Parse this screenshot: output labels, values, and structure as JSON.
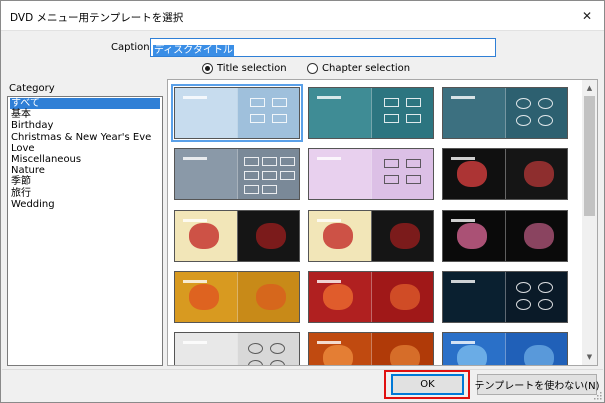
{
  "window": {
    "title": "DVD メニュー用テンプレートを選択",
    "close_glyph": "✕"
  },
  "caption": {
    "label": "Caption:",
    "value": "ディスクタイトル"
  },
  "selection_mode": {
    "options": [
      {
        "label": "Title selection",
        "checked": true
      },
      {
        "label": "Chapter selection",
        "checked": false
      }
    ]
  },
  "category": {
    "label": "Category",
    "items": [
      "すべて",
      "基本",
      "Birthday",
      "Christmas & New Year's Eve",
      "Love",
      "Miscellaneous",
      "Nature",
      "季節",
      "旅行",
      "Wedding"
    ],
    "selected_index": 0
  },
  "templates": {
    "selected_index": 0,
    "themes": [
      {
        "left": "#c7dcee",
        "right": "#9fc0dc",
        "style": "frames4",
        "accent": "#4a8cc8"
      },
      {
        "left": "#3f8c95",
        "right": "#2c7580",
        "style": "frames4",
        "accent": "#5fb0b8"
      },
      {
        "left": "#3c7080",
        "right": "#2d6070",
        "style": "ovals4",
        "accent": "#6aa8b8"
      },
      {
        "left": "#8a99a8",
        "right": "#7a8998",
        "style": "frames6",
        "accent": "#a8b8c8"
      },
      {
        "left": "#e8d0ee",
        "right": "#dcc0e6",
        "style": "party",
        "accent": "#c03030"
      },
      {
        "left": "#101010",
        "right": "#151515",
        "style": "balloons",
        "accent": "#e04040"
      },
      {
        "left": "#f2e6b8",
        "right": "#151515",
        "style": "xmas",
        "accent": "#c02020"
      },
      {
        "left": "#f2e6b8",
        "right": "#151515",
        "style": "xmas",
        "accent": "#c02020"
      },
      {
        "left": "#0a0a0a",
        "right": "#0a0a0a",
        "style": "fireworks",
        "accent": "#e06a9a"
      },
      {
        "left": "#d89a20",
        "right": "#c88a18",
        "style": "hearts",
        "accent": "#e05020"
      },
      {
        "left": "#b02020",
        "right": "#a01818",
        "style": "redhearts",
        "accent": "#f07030"
      },
      {
        "left": "#0a2030",
        "right": "#0a1a28",
        "style": "ovals4",
        "accent": "#2a6a8a"
      },
      {
        "left": "#e8e8e8",
        "right": "#d8d8d8",
        "style": "rings",
        "accent": "#808080"
      },
      {
        "left": "#c04a10",
        "right": "#b03a08",
        "style": "sunset",
        "accent": "#f09040"
      },
      {
        "left": "#2a70c8",
        "right": "#2060b8",
        "style": "city",
        "accent": "#80c0f0"
      }
    ]
  },
  "buttons": {
    "ok": "OK",
    "no_template": "テンプレートを使わない(N)"
  }
}
